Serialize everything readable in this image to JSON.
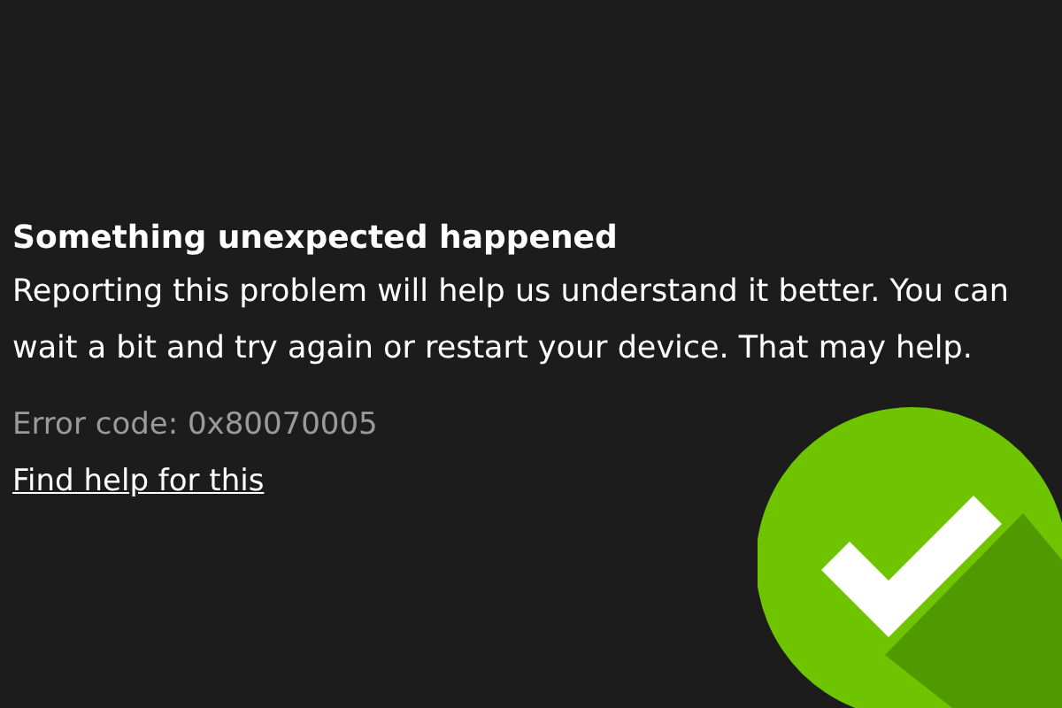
{
  "error_page": {
    "title": "Something unexpected happened",
    "message": "Reporting this problem will help us understand it better. You can wait a bit and try again or restart your device. That may help.",
    "error_code": "Error code: 0x80070005",
    "help_link": "Find help for this"
  }
}
